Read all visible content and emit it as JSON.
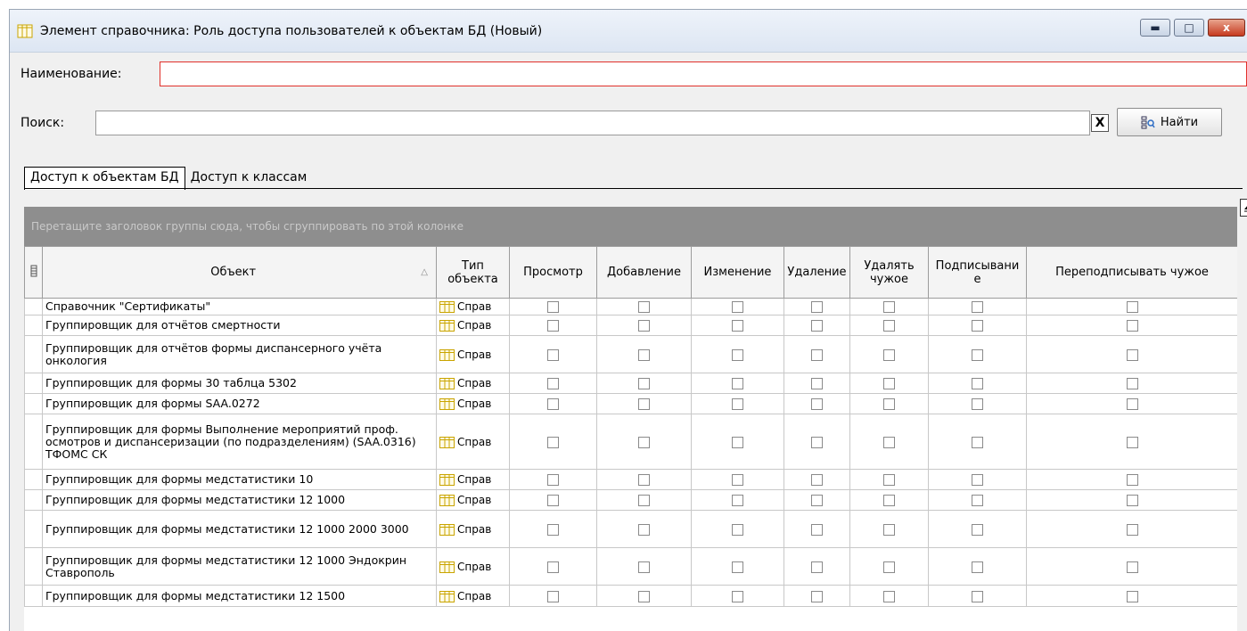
{
  "window": {
    "title": "Элемент справочника: Роль доступа пользователей к объектам БД (Новый)",
    "controls": {
      "minimize": "▬",
      "maximize": "□",
      "close": "x"
    }
  },
  "form": {
    "name_label": "Наименование:",
    "name_value": "",
    "search_label": "Поиск:",
    "search_value": "",
    "clear_label": "X",
    "find_label": "Найти"
  },
  "tabs": [
    {
      "label": "Доступ к объектам БД",
      "active": true
    },
    {
      "label": "Доступ к классам",
      "active": false
    }
  ],
  "grid": {
    "group_hint": "Перетащите заголовок группы сюда, чтобы сгруппировать по этой колонке",
    "columns": [
      "Объект",
      "Тип объекта",
      "Просмотр",
      "Добавление",
      "Изменение",
      "Удаление",
      "Удалять чужое",
      "Подписывани е",
      "Переподписывать чужое"
    ],
    "rows": [
      {
        "object": "Справочник \"Сертификаты\"",
        "type": "Справ"
      },
      {
        "object": "Группировщик для отчётов смертности",
        "type": "Справ"
      },
      {
        "object": "Группировщик для отчётов формы диспансерного учёта онкология",
        "type": "Справ"
      },
      {
        "object": "Группировщик для формы 30 таблца 5302",
        "type": "Справ"
      },
      {
        "object": "Группировщик для формы SAA.0272",
        "type": "Справ"
      },
      {
        "object": "Группировщик для формы Выполнение мероприятий проф. осмотров и диспансеризации (по подразделениям) (SAA.0316) ТФОМС СК",
        "type": "Справ"
      },
      {
        "object": "Группировщик для формы медстатистики 10",
        "type": "Справ"
      },
      {
        "object": "Группировщик для формы медстатистики 12 1000",
        "type": "Справ"
      },
      {
        "object": "Группировщик для формы медстатистики 12 1000 2000 3000",
        "type": "Справ"
      },
      {
        "object": "Группировщик для формы медстатистики 12 1000 Эндокрин Ставрополь",
        "type": "Справ"
      },
      {
        "object": "Группировщик для формы медстатистики 12 1500",
        "type": "Справ"
      }
    ],
    "row_heights": [
      19,
      23,
      42,
      23,
      23,
      62,
      23,
      23,
      42,
      42,
      24
    ]
  },
  "colors": {
    "accent_red": "#e0302a",
    "group_panel": "#8e8e8e",
    "titlebar": "#dde6f3"
  }
}
